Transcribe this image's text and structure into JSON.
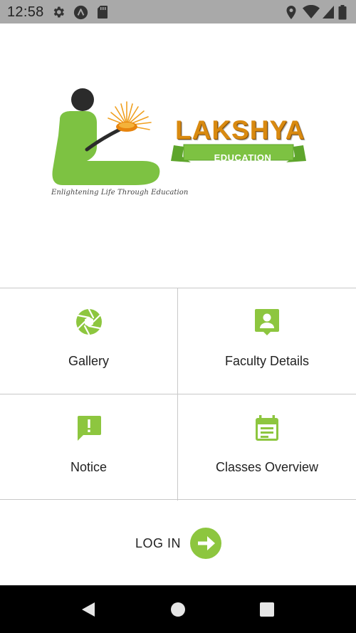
{
  "status_bar": {
    "time": "12:58",
    "icons": [
      "settings-icon",
      "a-icon",
      "sd-card-icon",
      "location-icon",
      "wifi-icon",
      "signal-icon",
      "battery-icon"
    ]
  },
  "logo": {
    "brand": "LAKSHYA",
    "ribbon": "EDUCATION",
    "tagline": "Enlightening Life Through Education",
    "colors": {
      "green": "#7dc242",
      "orange": "#d98a10",
      "dark": "#2b2b2b"
    }
  },
  "menu": {
    "accent": "#8dc63f",
    "items": [
      {
        "label": "Gallery",
        "icon": "camera-aperture-icon"
      },
      {
        "label": "Faculty Details",
        "icon": "contact-card-icon"
      },
      {
        "label": "Notice",
        "icon": "feedback-alert-icon"
      },
      {
        "label": "Classes Overview",
        "icon": "calendar-icon"
      }
    ]
  },
  "login": {
    "label": "LOG IN",
    "icon": "arrow-right-circle-icon"
  },
  "nav_bar": {
    "icons": [
      "back-icon",
      "home-icon",
      "recents-icon"
    ]
  }
}
